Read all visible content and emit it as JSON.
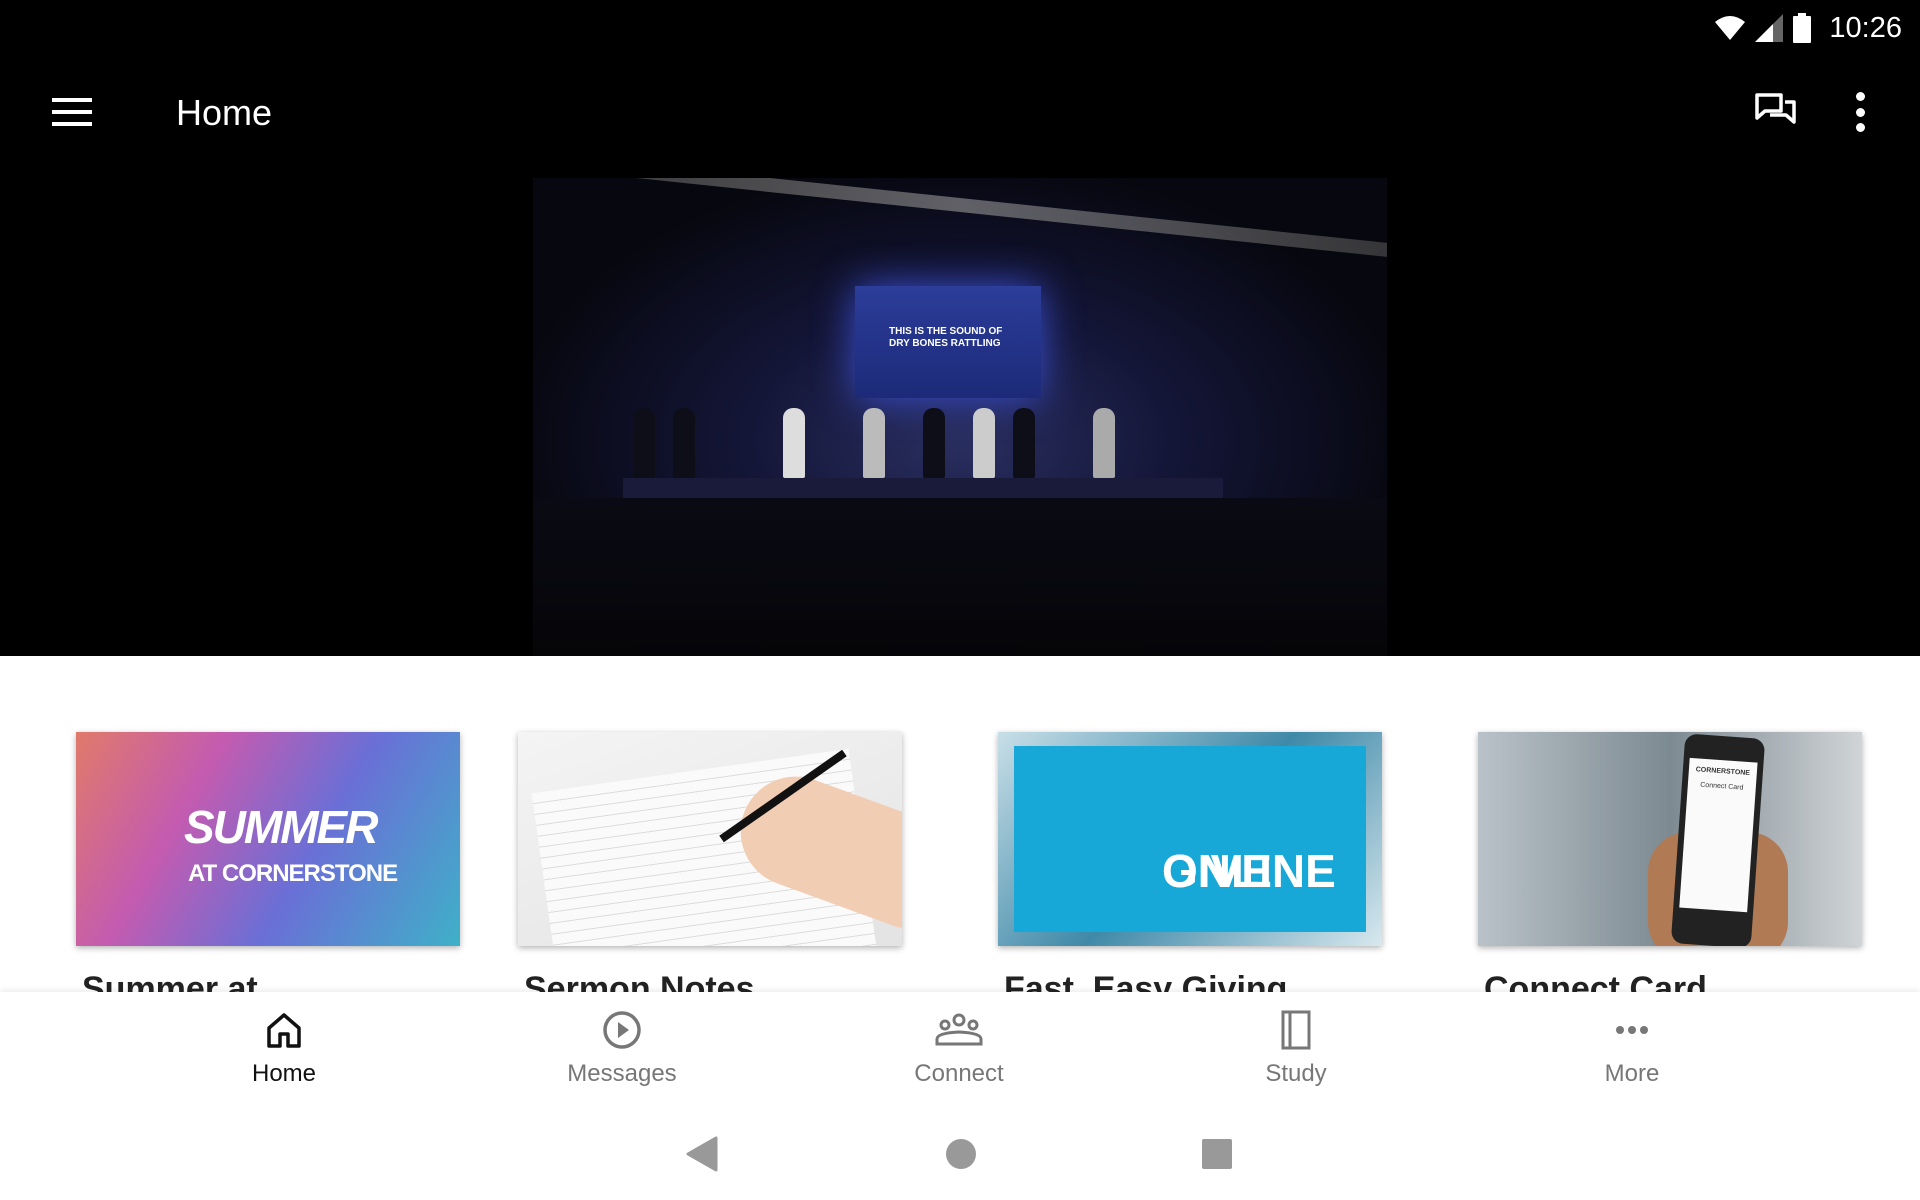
{
  "status_bar": {
    "time": "10:26",
    "icons": [
      "wifi-icon",
      "signal-icon",
      "battery-icon"
    ]
  },
  "app_bar": {
    "title": "Home",
    "icons": [
      "menu-icon",
      "chat-icon",
      "more-vert-icon"
    ]
  },
  "hero": {
    "screen_text": "THIS IS THE SOUND OF DRY BONES RATTLING"
  },
  "cards": [
    {
      "title": "Summer at",
      "image_text": [
        "SUMMER",
        "AT CORNERSTONE"
      ]
    },
    {
      "title": "Sermon Notes"
    },
    {
      "title": "Fast, Easy Giving",
      "image_text": [
        "GIVE",
        "ONLINE"
      ]
    },
    {
      "title": "Connect Card",
      "image_text": [
        "CORNERSTONE",
        "Connect Card"
      ]
    }
  ],
  "bottom_nav": {
    "active": "Home",
    "items": [
      {
        "label": "Home",
        "icon": "home-icon"
      },
      {
        "label": "Messages",
        "icon": "play-circle-icon"
      },
      {
        "label": "Connect",
        "icon": "group-icon"
      },
      {
        "label": "Study",
        "icon": "book-icon"
      },
      {
        "label": "More",
        "icon": "more-horiz-icon"
      }
    ]
  },
  "colors": {
    "active": "#111111",
    "inactive": "#777777",
    "give_blue": "#17a8d8"
  }
}
